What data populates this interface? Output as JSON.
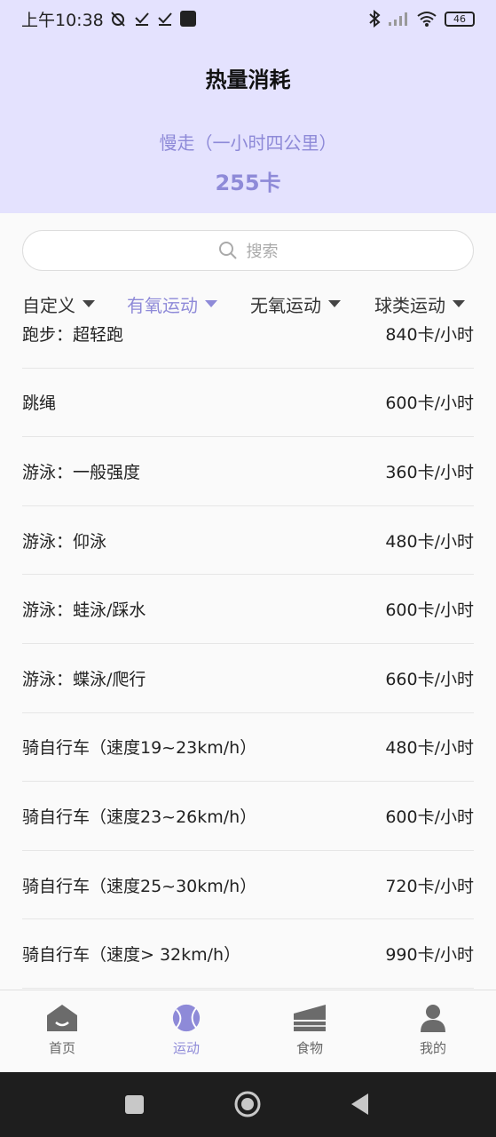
{
  "status_bar": {
    "time": "上午10:38",
    "battery": "46"
  },
  "header": {
    "title": "热量消耗",
    "exercise_name": "慢走（一小时四公里）",
    "calories": "255卡"
  },
  "search": {
    "placeholder": "搜索"
  },
  "filters": [
    {
      "label": "自定义",
      "active": false
    },
    {
      "label": "有氧运动",
      "active": true
    },
    {
      "label": "无氧运动",
      "active": false
    },
    {
      "label": "球类运动",
      "active": false
    }
  ],
  "list": [
    {
      "name": "跑步：超轻跑",
      "calories": "840卡/小时"
    },
    {
      "name": "跳绳",
      "calories": "600卡/小时"
    },
    {
      "name": "游泳：一般强度",
      "calories": "360卡/小时"
    },
    {
      "name": "游泳：仰泳",
      "calories": "480卡/小时"
    },
    {
      "name": "游泳：蛙泳/踩水",
      "calories": "600卡/小时"
    },
    {
      "name": "游泳：蝶泳/爬行",
      "calories": "660卡/小时"
    },
    {
      "name": "骑自行车（速度19~23km/h）",
      "calories": "480卡/小时"
    },
    {
      "name": "骑自行车（速度23~26km/h）",
      "calories": "600卡/小时"
    },
    {
      "name": "骑自行车（速度25~30km/h）",
      "calories": "720卡/小时"
    },
    {
      "name": "骑自行车（速度> 32km/h）",
      "calories": "990卡/小时"
    }
  ],
  "tabs": [
    {
      "label": "首页",
      "icon": "home-icon",
      "active": false
    },
    {
      "label": "运动",
      "icon": "tennis-ball-icon",
      "active": true
    },
    {
      "label": "食物",
      "icon": "cake-icon",
      "active": false
    },
    {
      "label": "我的",
      "icon": "user-icon",
      "active": false
    }
  ],
  "colors": {
    "accent": "#8e8ad8",
    "header_bg": "#e4e2fe",
    "nav_bg": "#1e1e1e"
  }
}
